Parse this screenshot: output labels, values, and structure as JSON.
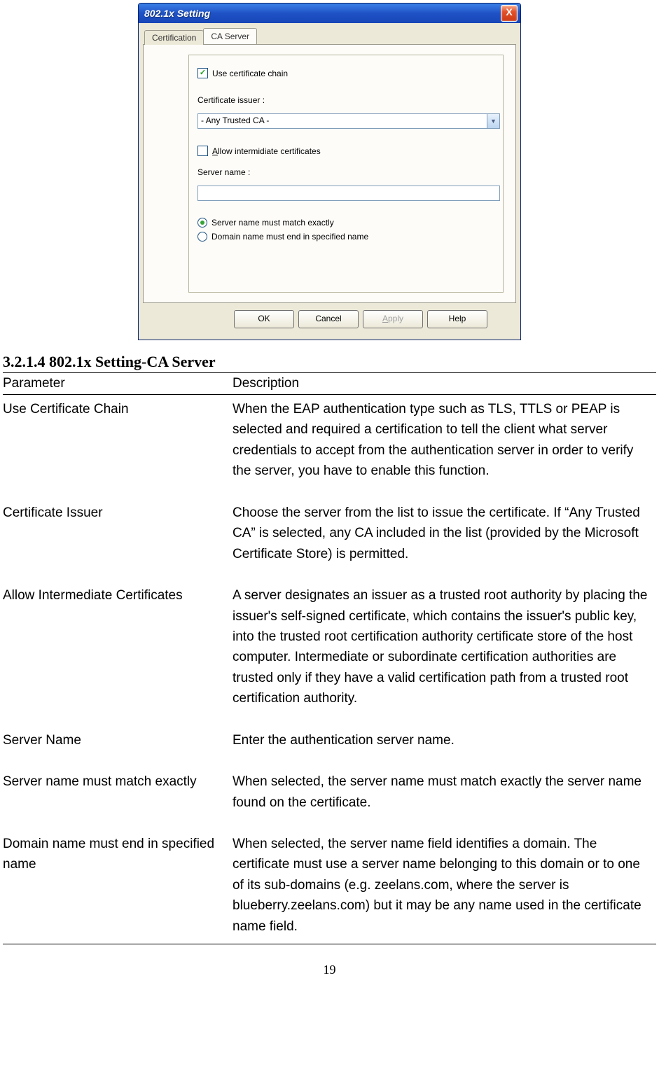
{
  "dialog": {
    "title": "802.1x Setting",
    "close_label": "X",
    "tabs": {
      "certification": "Certification",
      "ca_server": "CA Server"
    },
    "use_cert_chain_label": "Use certificate chain",
    "cert_issuer_label": "Certificate issuer :",
    "cert_issuer_value": "- Any Trusted CA -",
    "allow_intermediate_label": "Allow intermidiate certificates",
    "allow_intermediate_ul": "A",
    "server_name_label": "Server name :",
    "radio_match_exactly": "Server name must match exactly",
    "radio_domain_end": "Domain name must end in specified name",
    "buttons": {
      "ok": "OK",
      "cancel": "Cancel",
      "apply": "Apply",
      "apply_ul": "A",
      "help": "Help"
    }
  },
  "section": {
    "heading": "3.2.1.4    802.1x Setting-CA Server",
    "header_param": "Parameter",
    "header_desc": "Description",
    "rows": [
      {
        "param": "Use Certificate Chain",
        "desc": "When the EAP authentication type such as TLS, TTLS or PEAP is selected and required a certification to tell the client what server credentials to accept from the authentication server in order to verify the server, you have to enable this function."
      },
      {
        "param": "Certificate Issuer",
        "desc": "Choose the server from the list to issue the certificate. If “Any Trusted CA” is selected, any CA included in the list (provided by the Microsoft Certificate Store) is permitted."
      },
      {
        "param": "Allow Intermediate Certificates",
        "desc": "A server designates an issuer as a trusted root authority by placing the issuer's self-signed certificate, which contains the issuer's public key, into the trusted root certification authority certificate store of the host computer. Intermediate or subordinate certification authorities are trusted only if they have a valid certification path from a trusted root certification authority."
      },
      {
        "param": "Server Name",
        "desc": "Enter the authentication server name."
      },
      {
        "param": "Server name must match exactly",
        "desc": "When selected, the server name must match exactly the server name found on the certificate."
      },
      {
        "param": "Domain name must end in specified name",
        "desc": "When selected, the server name field identifies a domain. The certificate must use a server name belonging to this domain or to one of its sub-domains (e.g. zeelans.com, where the server is blueberry.zeelans.com) but it may be any name used in the certificate name field."
      }
    ]
  },
  "page_number": "19"
}
